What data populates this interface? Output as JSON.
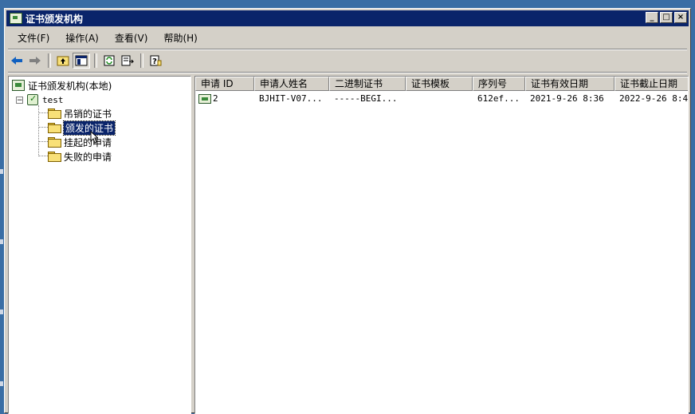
{
  "window": {
    "title": "证书颁发机构"
  },
  "menu": [
    {
      "label": "文件(F)"
    },
    {
      "label": "操作(A)"
    },
    {
      "label": "查看(V)"
    },
    {
      "label": "帮助(H)"
    }
  ],
  "toolbar": {
    "buttons": [
      "back-icon",
      "forward-icon",
      "up-level-icon",
      "show-hide-tree-icon",
      "refresh-icon",
      "export-list-icon",
      "help-icon"
    ]
  },
  "tree": {
    "root": "证书颁发机构(本地)",
    "ca": "test",
    "folders": [
      "吊销的证书",
      "颁发的证书",
      "挂起的申请",
      "失败的申请"
    ],
    "selected_folder": "颁发的证书"
  },
  "list": {
    "columns": [
      "申请 ID",
      "申请人姓名",
      "二进制证书",
      "证书模板",
      "序列号",
      "证书有效日期",
      "证书截止日期"
    ],
    "rows": [
      [
        "2",
        "BJHIT-V07...",
        "-----BEGI...",
        "",
        "612ef...",
        "2021-9-26 8:36",
        "2022-9-26 8:4"
      ]
    ]
  }
}
